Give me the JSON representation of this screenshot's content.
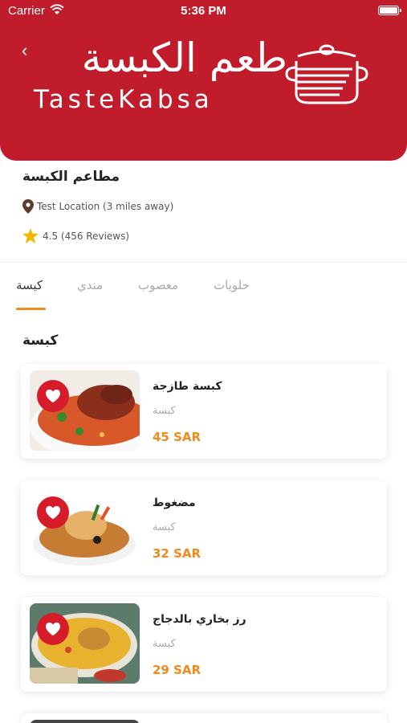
{
  "status_bar": {
    "carrier": "Carrier",
    "time": "5:36 PM"
  },
  "header": {
    "logo_arabic": "طعم الكبسة",
    "logo_english": "TasteKabsa",
    "background_color": "#c01c2c"
  },
  "restaurant": {
    "name": "مطاعم الكبسة",
    "location": "Test Location (3 miles away)",
    "rating_text": "4.5 (456 Reviews)"
  },
  "tabs": [
    {
      "label": "كبسة",
      "active": true
    },
    {
      "label": "مندي",
      "active": false
    },
    {
      "label": "معصوب",
      "active": false
    },
    {
      "label": "حلويات",
      "active": false
    }
  ],
  "section_title": "كبسة",
  "items": [
    {
      "name": "كبسة طازجة",
      "category": "كبسة",
      "price": "45 SAR"
    },
    {
      "name": "مضغوط",
      "category": "كبسة",
      "price": "32 SAR"
    },
    {
      "name": "رز بخاري بالدجاج",
      "category": "كبسة",
      "price": "29 SAR"
    }
  ],
  "colors": {
    "accent": "#f08a1d",
    "brand_red": "#c01c2c",
    "favorite_red": "#d61b2b"
  }
}
